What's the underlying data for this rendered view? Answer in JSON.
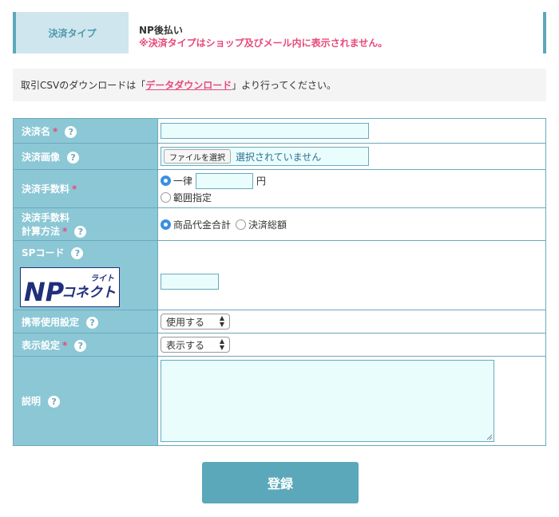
{
  "header": {
    "type_label": "決済タイプ",
    "type_name": "NP後払い",
    "type_note": "※決済タイプはショップ及びメール内に表示されません。"
  },
  "csv_notice": {
    "prefix": "取引CSVのダウンロードは「",
    "link": "データダウンロード",
    "suffix": "」より行ってください。"
  },
  "help_glyph": "?",
  "required_mark": "*",
  "form": {
    "name_label": "決済名",
    "name_value": "",
    "image_label": "決済画像",
    "file_button": "ファイルを選択",
    "file_status": "選択されていません",
    "fee_label": "決済手数料",
    "fee_option_flat": "一律",
    "fee_value": "",
    "fee_unit": "円",
    "fee_option_range": "範囲指定",
    "fee_calc_label_line1": "決済手数料",
    "fee_calc_label_line2": "計算方法",
    "fee_calc_option1": "商品代金合計",
    "fee_calc_option2": "決済総額",
    "sp_label": "SPコード",
    "sp_value": "",
    "mobile_label": "携帯使用設定",
    "mobile_value": "使用する",
    "display_label": "表示設定",
    "display_value": "表示する",
    "desc_label": "説明",
    "desc_value": ""
  },
  "logo": {
    "main": "NP",
    "sub1": "ライト",
    "sub2": "コネクト"
  },
  "submit_label": "登録",
  "colors": {
    "accent": "#5ba8bb",
    "label_bg": "#8bc7d5",
    "warning_pink": "#e8497a",
    "input_bg": "#eafdfd"
  }
}
